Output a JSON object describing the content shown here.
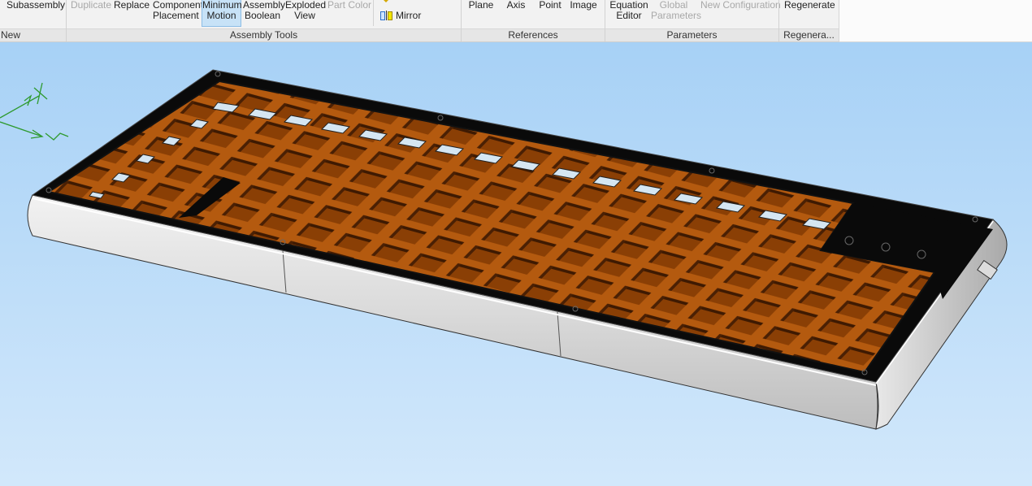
{
  "ribbon": {
    "buttons": {
      "subassembly": "Subassembly",
      "duplicate": "Duplicate",
      "replace": "Replace",
      "component_1": "Component",
      "component_2": "Placement",
      "min_motion_1": "Minimum",
      "min_motion_2": "Motion",
      "assembly_boolean_1": "Assembly",
      "assembly_boolean_2": "Boolean",
      "exploded_view_1": "Exploded",
      "exploded_view_2": "View",
      "part_color": "Part Color",
      "mirror": "Mirror",
      "plane": "Plane",
      "axis": "Axis",
      "point": "Point",
      "image": "Image",
      "equation_editor_1": "Equation",
      "equation_editor_2": "Editor",
      "global_params_1": "Global",
      "global_params_2": "Parameters",
      "new_configuration": "New Configuration",
      "regenerate": "Regenerate"
    },
    "groups": {
      "new": "New",
      "assembly_tools": "Assembly Tools",
      "references": "References",
      "parameters": "Parameters",
      "regenerate": "Regenera..."
    }
  },
  "colors": {
    "viewport_top": "#a7d1f6",
    "viewport_bottom": "#d2e8fb",
    "case_black": "#0a0a0a",
    "plate_orange": "#a4520c",
    "side_grey": "#d8d8d8",
    "active_button": "#c7e2f7",
    "triad_green": "#2e9a2e"
  },
  "icons": {
    "mirror": "mirror-icon",
    "triad": "coordinate-triad-icon"
  }
}
